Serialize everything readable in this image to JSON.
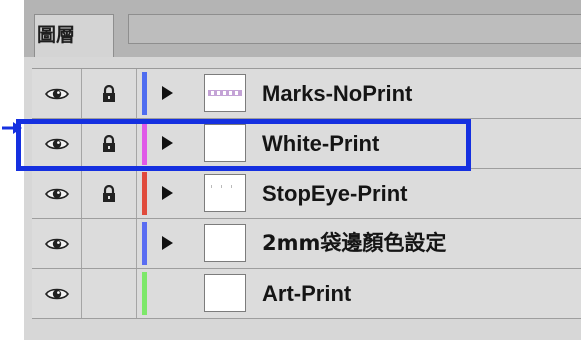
{
  "panel": {
    "tab_label": "圖層"
  },
  "layers": [
    {
      "name": "Marks-NoPrint",
      "visible": true,
      "locked": true,
      "color": "#4f6df0",
      "expandable": true,
      "thumb_marks": true
    },
    {
      "name": "White-Print",
      "visible": true,
      "locked": true,
      "color": "#e05ae8",
      "expandable": true,
      "thumb_marks": false
    },
    {
      "name": "StopEye-Print",
      "visible": true,
      "locked": true,
      "color": "#e04b3c",
      "expandable": true,
      "thumb_marks": false
    },
    {
      "name": "2mm袋邊顏色設定",
      "visible": true,
      "locked": false,
      "color": "#5a6df2",
      "expandable": true,
      "thumb_marks": false
    },
    {
      "name": "Art-Print",
      "visible": true,
      "locked": false,
      "color": "#7de86a",
      "expandable": false,
      "thumb_marks": false
    }
  ],
  "annotation": {
    "highlight_color": "#1530e0",
    "highlighted_layer": "White-Print"
  }
}
